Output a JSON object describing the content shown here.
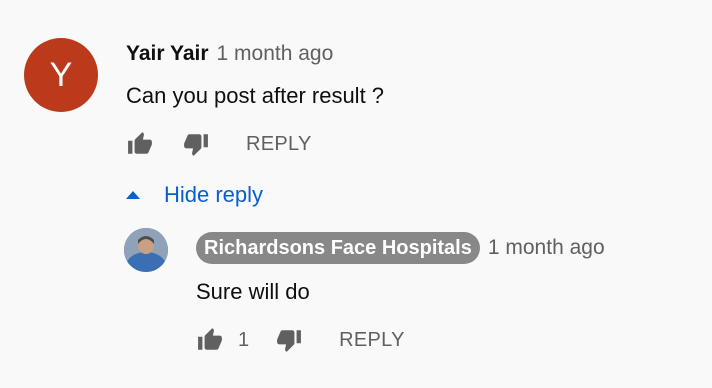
{
  "comment": {
    "avatar_letter": "Y",
    "avatar_color": "#bb3a1b",
    "author": "Yair Yair",
    "time": "1 month ago",
    "text": "Can you post after result ?",
    "like_icon": "thumbs-up-icon",
    "dislike_icon": "thumbs-down-icon",
    "reply_label": "REPLY",
    "hide_reply_label": "Hide reply",
    "hide_reply_icon": "caret-up-icon"
  },
  "reply": {
    "author": "Richardsons Face Hospitals",
    "time": "1 month ago",
    "text": "Sure will do",
    "like_count": "1",
    "reply_label": "REPLY",
    "badge_color": "#888888"
  },
  "colors": {
    "background": "#f9f9f9",
    "link_blue": "#065fd4",
    "muted": "#606060"
  }
}
